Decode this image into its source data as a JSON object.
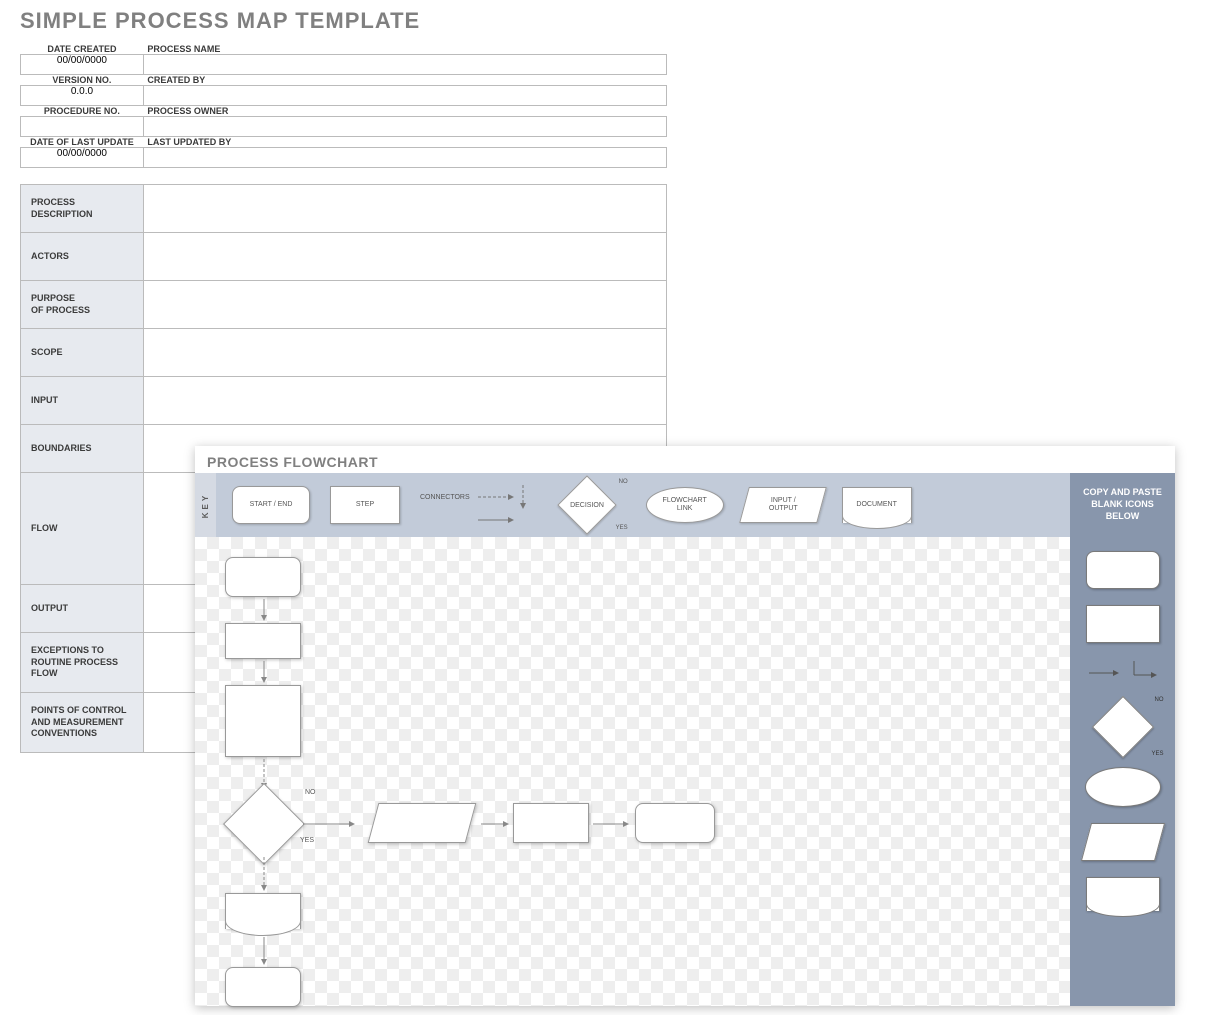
{
  "title": "SIMPLE PROCESS MAP TEMPLATE",
  "meta": {
    "date_created_label": "DATE CREATED",
    "date_created_value": "00/00/0000",
    "process_name_label": "PROCESS NAME",
    "process_name_value": "",
    "version_no_label": "VERSION NO.",
    "version_no_value": "0.0.0",
    "created_by_label": "CREATED BY",
    "created_by_value": "",
    "procedure_no_label": "PROCEDURE NO.",
    "procedure_no_value": "",
    "process_owner_label": "PROCESS OWNER",
    "process_owner_value": "",
    "date_last_update_label": "DATE OF LAST UPDATE",
    "date_last_update_value": "00/00/0000",
    "last_updated_by_label": "LAST UPDATED BY",
    "last_updated_by_value": ""
  },
  "details": {
    "process_description": {
      "label": "PROCESS\nDESCRIPTION",
      "value": ""
    },
    "actors": {
      "label": "ACTORS",
      "value": ""
    },
    "purpose": {
      "label": "PURPOSE\nOF PROCESS",
      "value": ""
    },
    "scope": {
      "label": "SCOPE",
      "value": ""
    },
    "input": {
      "label": "INPUT",
      "value": ""
    },
    "boundaries": {
      "label": "BOUNDARIES",
      "value": ""
    },
    "flow": {
      "label": "FLOW",
      "value": ""
    },
    "output": {
      "label": "OUTPUT",
      "value": ""
    },
    "exceptions": {
      "label": "EXCEPTIONS TO\nROUTINE PROCESS FLOW",
      "value": ""
    },
    "points_of_control": {
      "label": "POINTS OF CONTROL\nAND MEASUREMENT\nCONVENTIONS",
      "value": ""
    }
  },
  "flowchart": {
    "title": "PROCESS FLOWCHART",
    "key_label": "KEY",
    "key": {
      "start_end": "START / END",
      "step": "STEP",
      "connectors": "CONNECTORS",
      "decision": "DECISION",
      "decision_no": "NO",
      "decision_yes": "YES",
      "flowchart_link": "FLOWCHART\nLINK",
      "input_output": "INPUT /\nOUTPUT",
      "document": "DOCUMENT"
    },
    "copy_paste_hint": "COPY AND PASTE\nBLANK ICONS\nBELOW",
    "palette": {
      "no": "NO",
      "yes": "YES"
    },
    "canvas_labels": {
      "no": "NO",
      "yes": "YES"
    }
  }
}
